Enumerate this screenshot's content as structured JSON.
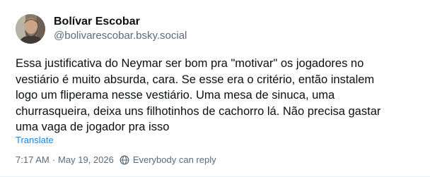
{
  "author": {
    "display_name": "Bolívar Escobar",
    "handle": "@bolivarescobar.bsky.social",
    "avatar_icon": "user-avatar"
  },
  "post": {
    "text": "Essa justificativa do Neymar ser bom pra \"motivar\" os jogadores no\nvestiário é muito absurda, cara. Se esse era o critério, então instalem\nlogo um fliperama nesse vestiário. Uma mesa de sinuca, uma\nchurrasqueira, deixa uns filhotinhos de cachorro lá. Não precisa gastar\numa vaga de jogador pra isso",
    "translate_label": "Translate"
  },
  "meta": {
    "time": "7:17 AM",
    "separator": "·",
    "date": "May 19, 2026",
    "reply_setting": "Everybody can reply",
    "reply_icon": "globe-icon"
  },
  "colors": {
    "text": "#0b0f14",
    "muted": "#5b6b7c",
    "link": "#1083fe"
  }
}
